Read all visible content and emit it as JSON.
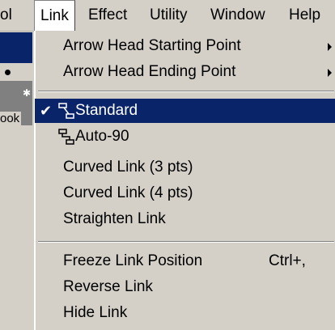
{
  "menubar": {
    "items": [
      {
        "label": "ol"
      },
      {
        "label": "Link"
      },
      {
        "label": "Effect"
      },
      {
        "label": "Utility"
      },
      {
        "label": "Window"
      },
      {
        "label": "Help"
      }
    ]
  },
  "background": {
    "label": "ook"
  },
  "menu": {
    "arrow_head_start": "Arrow Head Starting Point",
    "arrow_head_end": "Arrow Head Ending Point",
    "standard": "Standard",
    "auto90": "Auto-90",
    "curved3": "Curved Link (3 pts)",
    "curved4": "Curved Link (4 pts)",
    "straighten": "Straighten Link",
    "freeze": "Freeze Link Position",
    "freeze_shortcut": "Ctrl+,",
    "reverse": "Reverse Link",
    "hide": "Hide Link",
    "check_glyph": "✔"
  },
  "colors": {
    "menu_bg": "#d4d0c8",
    "highlight": "#0a246a"
  },
  "icons": {
    "submenu": "chevron-right-icon",
    "standard": "standard-link-icon",
    "auto90": "auto90-link-icon"
  }
}
